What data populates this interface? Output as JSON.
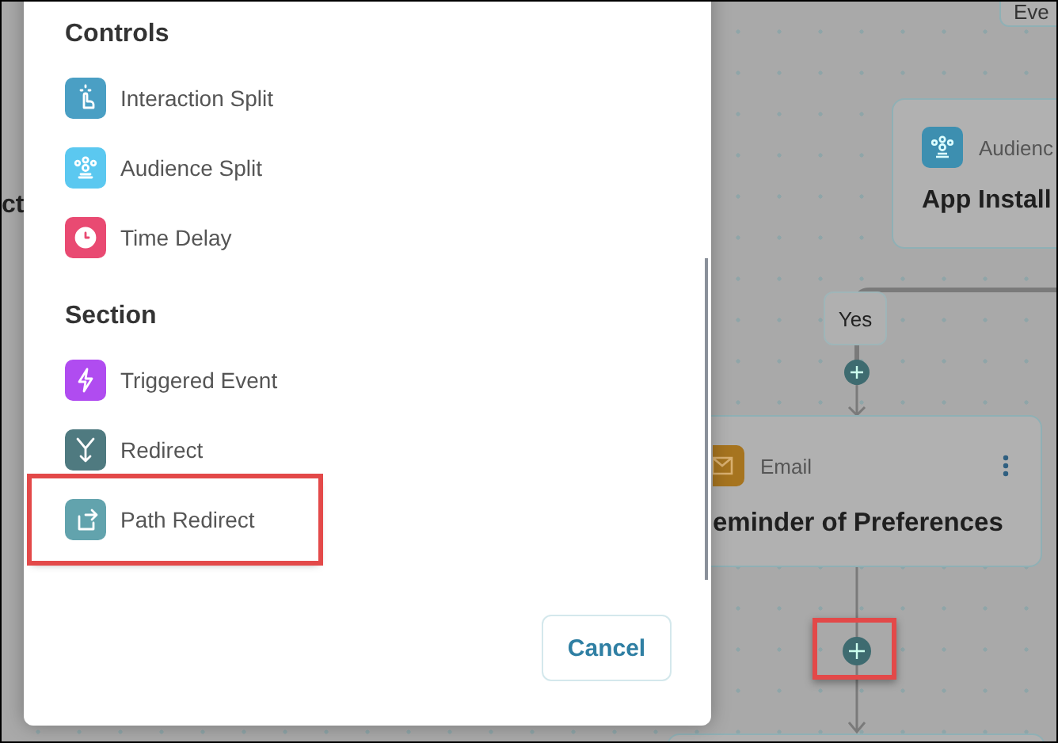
{
  "canvas": {
    "left_fragment": "ct",
    "top_card": {
      "text": "Eve"
    },
    "audience_card": {
      "type": "Audienc",
      "title": "App Install"
    },
    "branch_label": "Yes",
    "email_card": {
      "type": "Email",
      "title": "eminder of Preferences"
    },
    "add_step": {
      "highlighted": true
    }
  },
  "modal": {
    "groups": [
      {
        "heading": "Controls",
        "items": [
          {
            "label": "Interaction Split",
            "kind": "interaction",
            "color": "#4a9fc4",
            "highlighted": false
          },
          {
            "label": "Audience Split",
            "kind": "audience",
            "color": "#5bc8f0",
            "highlighted": false
          },
          {
            "label": "Time Delay",
            "kind": "delay",
            "color": "#e94a72",
            "highlighted": false
          }
        ]
      },
      {
        "heading": "Section",
        "items": [
          {
            "label": "Triggered Event",
            "kind": "event",
            "color": "#b04cf0",
            "highlighted": false
          },
          {
            "label": "Redirect",
            "kind": "redirect",
            "color": "#4f7a80",
            "highlighted": false
          },
          {
            "label": "Path Redirect",
            "kind": "path",
            "color": "#62a3ad",
            "highlighted": true
          }
        ]
      }
    ],
    "cancel": "Cancel"
  }
}
